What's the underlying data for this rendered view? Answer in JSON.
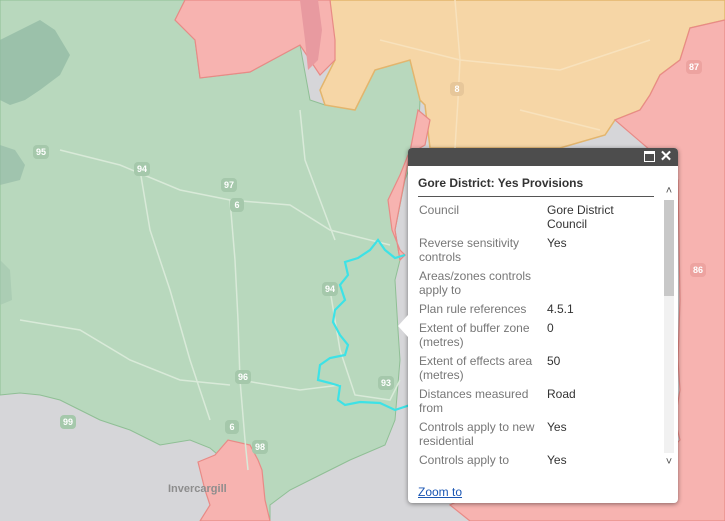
{
  "map": {
    "city_label": "Invercargill",
    "road_shields": [
      "95",
      "94",
      "97",
      "6",
      "94",
      "96",
      "93",
      "6",
      "98",
      "99",
      "8",
      "87",
      "86"
    ],
    "colors": {
      "water": "#d6d6d9",
      "green_region": "#b8d8bd",
      "orange_region": "#f6d6a6",
      "red_region": "#f7b3b0",
      "highlight_outline": "#3de2e6"
    }
  },
  "popup": {
    "title": "Gore District: Yes Provisions",
    "rows": [
      {
        "label": "Council",
        "value": "Gore District Council"
      },
      {
        "label": "Reverse sensitivity controls",
        "value": "Yes"
      },
      {
        "label": "Areas/zones controls apply to",
        "value": ""
      },
      {
        "label": "Plan rule references",
        "value": "4.5.1"
      },
      {
        "label": "Extent of buffer zone (metres)",
        "value": "0"
      },
      {
        "label": "Extent of effects area (metres)",
        "value": "50"
      },
      {
        "label": "Distances measured from",
        "value": "Road"
      },
      {
        "label": "Controls apply to new residential",
        "value": "Yes"
      },
      {
        "label": "Controls apply to",
        "value": "Yes"
      }
    ],
    "zoom_link": "Zoom to",
    "maximize_icon": "maximize-icon",
    "close_icon": "close-icon"
  }
}
